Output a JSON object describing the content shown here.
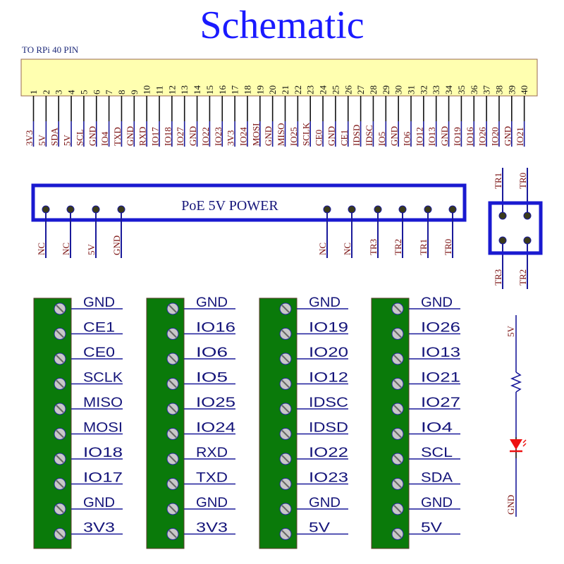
{
  "title": "Schematic",
  "header": {
    "caption": "TO RPi 40 PIN",
    "fill_color": "#ffffb0",
    "pins": [
      {
        "num": "1",
        "signal": "3V3"
      },
      {
        "num": "2",
        "signal": "5V"
      },
      {
        "num": "3",
        "signal": "SDA"
      },
      {
        "num": "4",
        "signal": "5V"
      },
      {
        "num": "5",
        "signal": "SCL"
      },
      {
        "num": "6",
        "signal": "GND"
      },
      {
        "num": "7",
        "signal": "IO4"
      },
      {
        "num": "8",
        "signal": "TXD"
      },
      {
        "num": "9",
        "signal": "GND"
      },
      {
        "num": "10",
        "signal": "RXD"
      },
      {
        "num": "11",
        "signal": "IO17"
      },
      {
        "num": "12",
        "signal": "IO18"
      },
      {
        "num": "13",
        "signal": "IO27"
      },
      {
        "num": "14",
        "signal": "GND"
      },
      {
        "num": "15",
        "signal": "IO22"
      },
      {
        "num": "16",
        "signal": "IO23"
      },
      {
        "num": "17",
        "signal": "3V3"
      },
      {
        "num": "18",
        "signal": "IO24"
      },
      {
        "num": "19",
        "signal": "MOSI"
      },
      {
        "num": "20",
        "signal": "GND"
      },
      {
        "num": "21",
        "signal": "MISO"
      },
      {
        "num": "22",
        "signal": "IO25"
      },
      {
        "num": "23",
        "signal": "SCLK"
      },
      {
        "num": "24",
        "signal": "CE0"
      },
      {
        "num": "25",
        "signal": "GND"
      },
      {
        "num": "26",
        "signal": "CE1"
      },
      {
        "num": "27",
        "signal": "IDSD"
      },
      {
        "num": "28",
        "signal": "IDSC"
      },
      {
        "num": "29",
        "signal": "IO5"
      },
      {
        "num": "30",
        "signal": "GND"
      },
      {
        "num": "31",
        "signal": "IO6"
      },
      {
        "num": "32",
        "signal": "IO12"
      },
      {
        "num": "33",
        "signal": "IO13"
      },
      {
        "num": "34",
        "signal": "GND"
      },
      {
        "num": "35",
        "signal": "IO19"
      },
      {
        "num": "36",
        "signal": "IO16"
      },
      {
        "num": "37",
        "signal": "IO26"
      },
      {
        "num": "38",
        "signal": "IO20"
      },
      {
        "num": "39",
        "signal": "GND"
      },
      {
        "num": "40",
        "signal": "IO21"
      }
    ]
  },
  "poe": {
    "label": "PoE 5V POWER",
    "left_pins": [
      "NC",
      "NC",
      "5V",
      "GND"
    ],
    "right_pins": [
      "NC",
      "NC",
      "TR3",
      "TR2",
      "TR1",
      "TR0"
    ],
    "box_color": "#1a1ad0",
    "pad_color": "#3a3a1a"
  },
  "transformer": {
    "top_pins": [
      "TR1",
      "TR0"
    ],
    "bottom_pins": [
      "TR3",
      "TR2"
    ]
  },
  "terminal_blocks": [
    {
      "labels": [
        "GND",
        "CE1",
        "CE0",
        "SCLK",
        "MISO",
        "MOSI",
        "IO18",
        "IO17",
        "GND",
        "3V3"
      ]
    },
    {
      "labels": [
        "GND",
        "IO16",
        "IO6",
        "IO5",
        "IO25",
        "IO24",
        "RXD",
        "TXD",
        "GND",
        "3V3"
      ]
    },
    {
      "labels": [
        "GND",
        "IO19",
        "IO20",
        "IO12",
        "IDSC",
        "IDSD",
        "IO22",
        "IO23",
        "GND",
        "5V"
      ]
    },
    {
      "labels": [
        "GND",
        "IO26",
        "IO13",
        "IO21",
        "IO27",
        "IO4",
        "SCL",
        "SDA",
        "GND",
        "5V"
      ]
    }
  ],
  "terminal_color": "#0a7a0a",
  "led_circuit": {
    "top_label": "5V",
    "bottom_label": "GND",
    "led_color": "#ee1111"
  }
}
